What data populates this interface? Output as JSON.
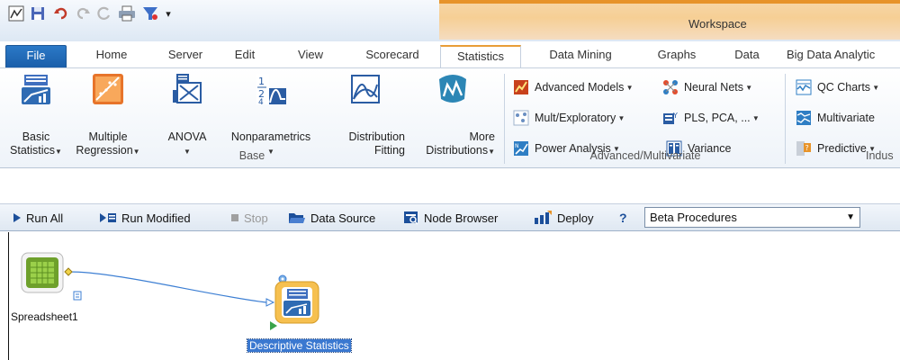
{
  "window": {
    "title": "Workspace"
  },
  "tabs": [
    {
      "label": "File"
    },
    {
      "label": "Home"
    },
    {
      "label": "Server"
    },
    {
      "label": "Edit"
    },
    {
      "label": "View"
    },
    {
      "label": "Scorecard"
    },
    {
      "label": "Statistics"
    },
    {
      "label": "Data Mining"
    },
    {
      "label": "Graphs"
    },
    {
      "label": "Data"
    },
    {
      "label": "Big Data Analytic"
    }
  ],
  "ribbon": {
    "base": {
      "group_label": "Base",
      "basic_statistics": {
        "line1": "Basic",
        "line2": "Statistics"
      },
      "multiple_regression": {
        "line1": "Multiple",
        "line2": "Regression"
      },
      "anova": {
        "line1": "ANOVA"
      },
      "nonparametrics": {
        "line1": "Nonparametrics"
      },
      "distribution_fitting": {
        "line1": "Distribution",
        "line2": "Fitting"
      },
      "more_distributions": {
        "line1": "More",
        "line2": "Distributions"
      }
    },
    "advanced": {
      "group_label": "Advanced/Multivariate",
      "advanced_models": "Advanced Models",
      "neural_nets": "Neural Nets",
      "mult_exploratory": "Mult/Exploratory",
      "pls_pca": "PLS, PCA, ...",
      "power_analysis": "Power Analysis",
      "variance": "Variance"
    },
    "industrial": {
      "group_label": "Indus",
      "qc_charts": "QC Charts",
      "multivariate": "Multivariate",
      "predictive": "Predictive"
    }
  },
  "toolbar": {
    "run_all": "Run All",
    "run_modified": "Run Modified",
    "stop": "Stop",
    "data_source": "Data Source",
    "node_browser": "Node Browser",
    "deploy": "Deploy",
    "help": "?",
    "procedure_select": "Beta Procedures"
  },
  "canvas": {
    "nodes": [
      {
        "label": "Spreadsheet1"
      },
      {
        "label": "Descriptive Statistics"
      }
    ]
  },
  "colors": {
    "accent_orange": "#e89d38",
    "file_tab_blue": "#1a5da8",
    "selection_blue": "#3a78d0",
    "node_green": "#6ea02b"
  }
}
